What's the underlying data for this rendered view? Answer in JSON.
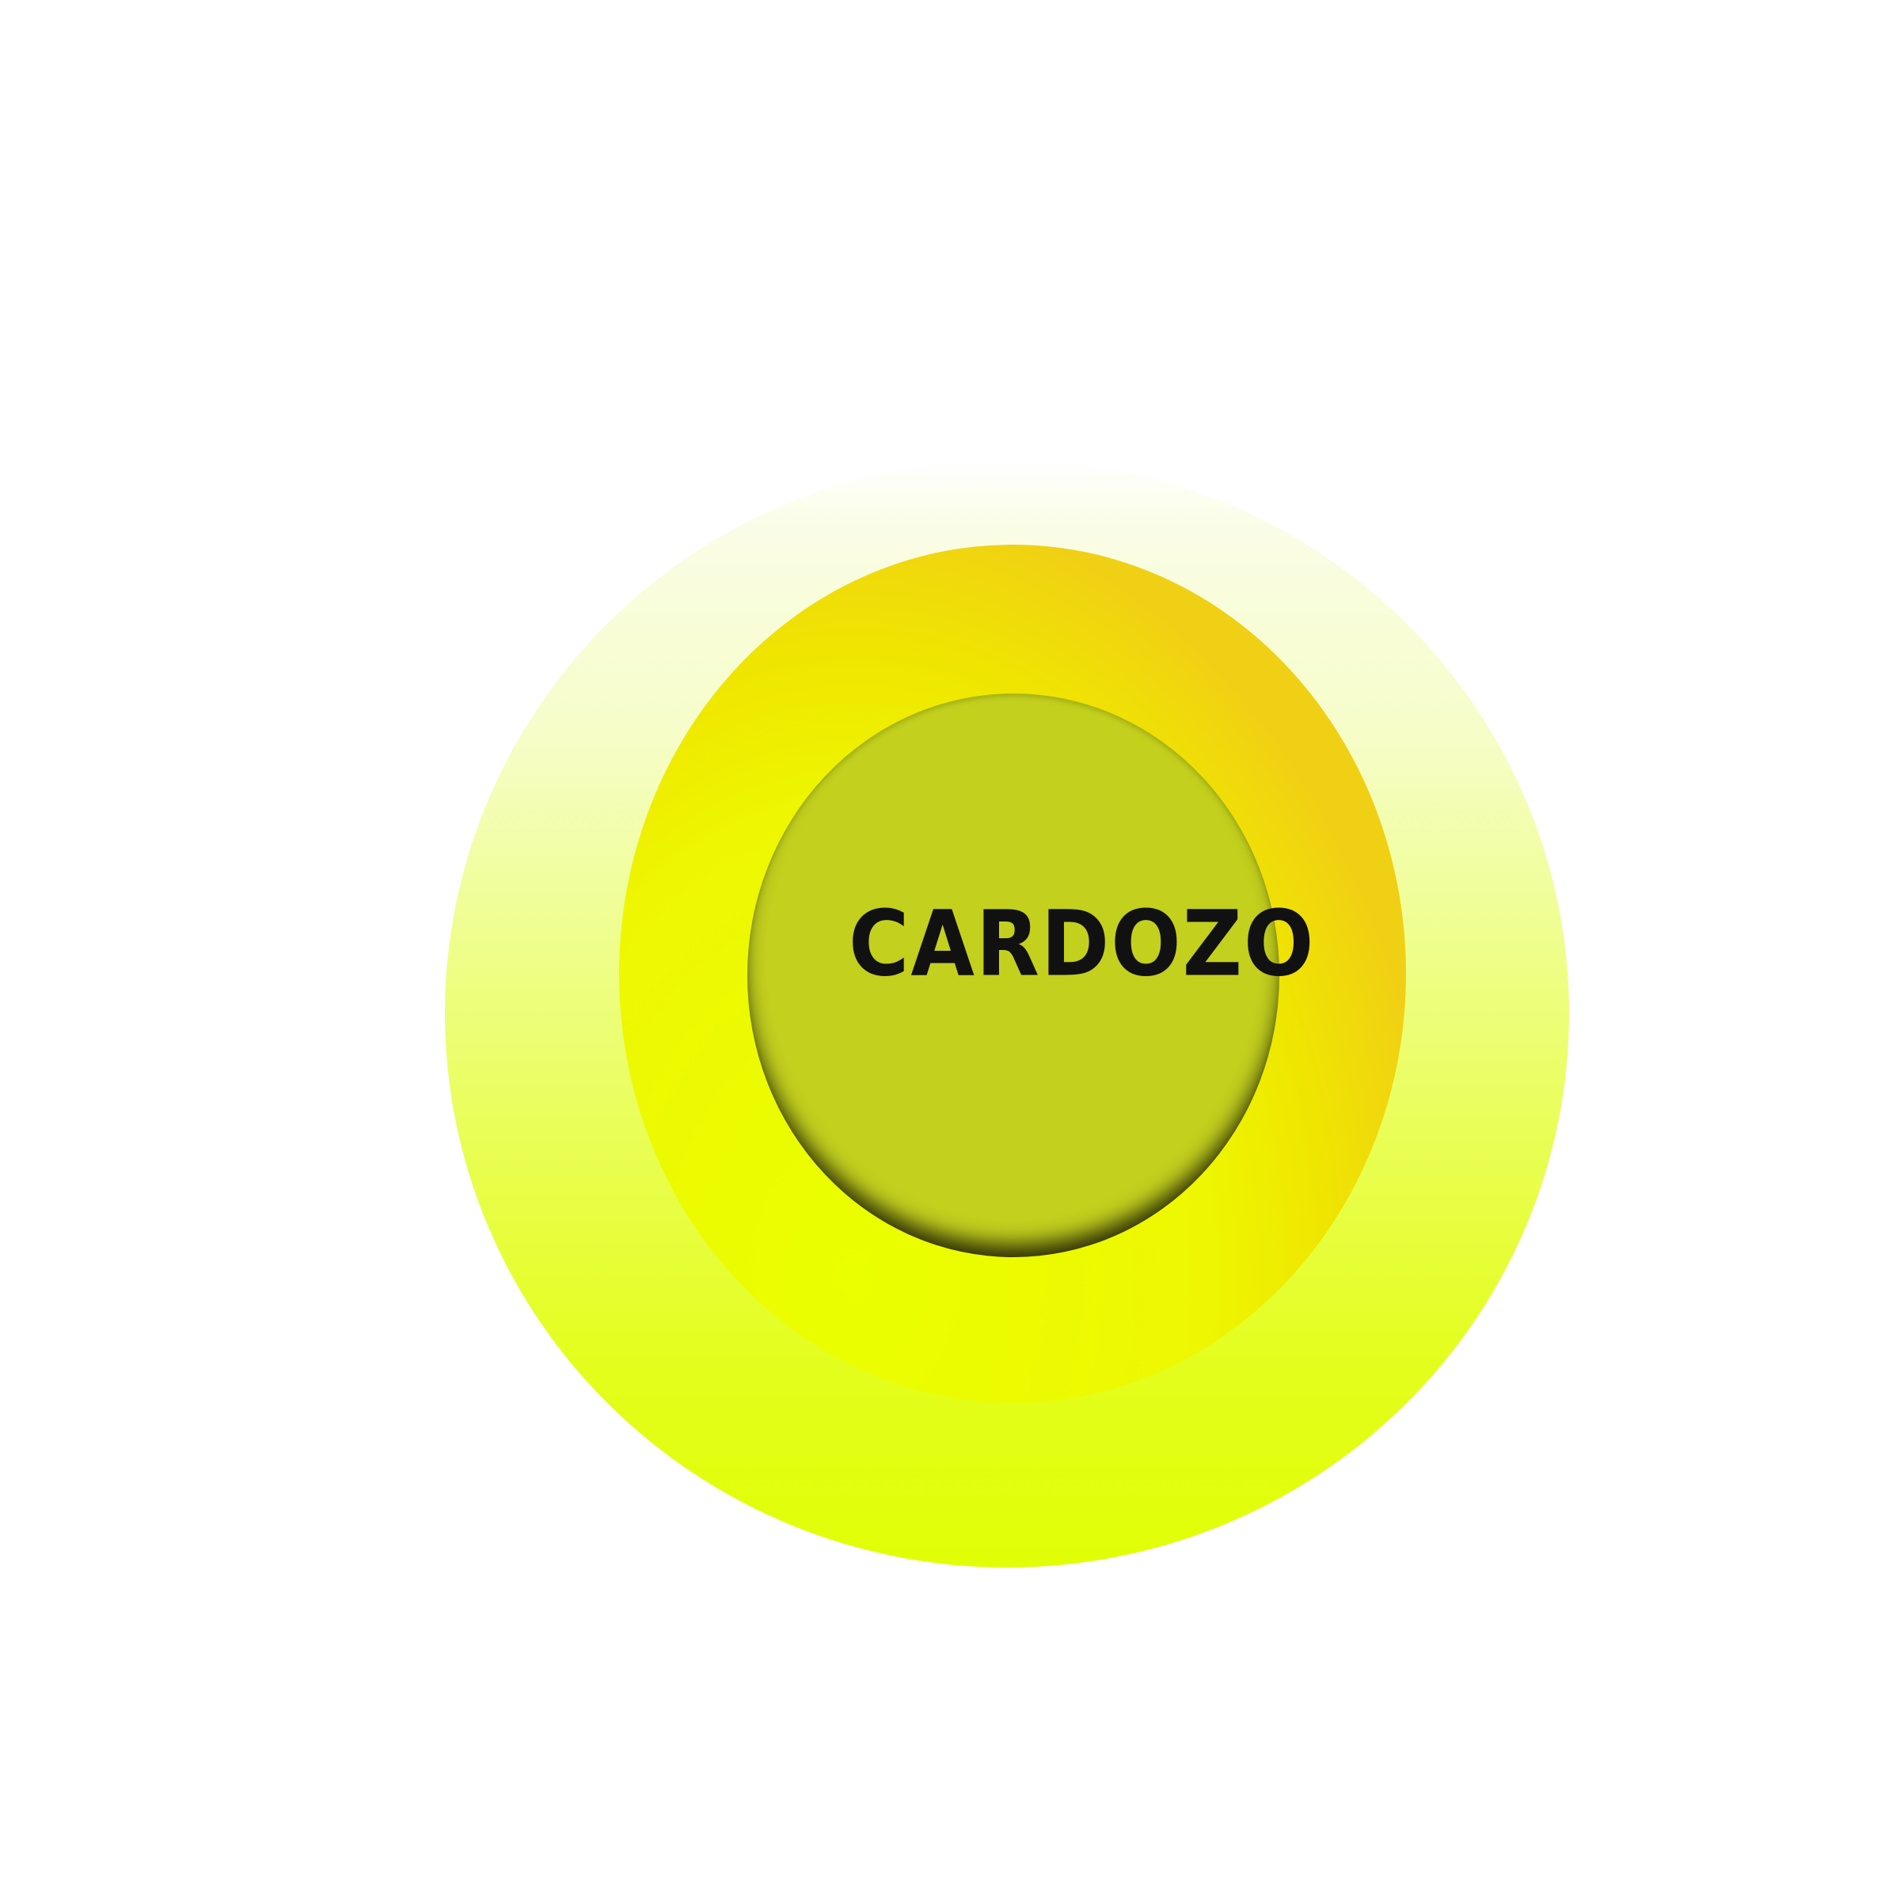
{
  "logo": {
    "text": "CARDOZO",
    "colors": {
      "outer_ring_top": "#fafde6",
      "outer_ring_bottom": "#e0ff05",
      "middle_ring_yellow": "#eaff00",
      "middle_ring_orange": "#f0cf14",
      "inner_disc": "#c3d01e",
      "text": "#111111"
    }
  }
}
